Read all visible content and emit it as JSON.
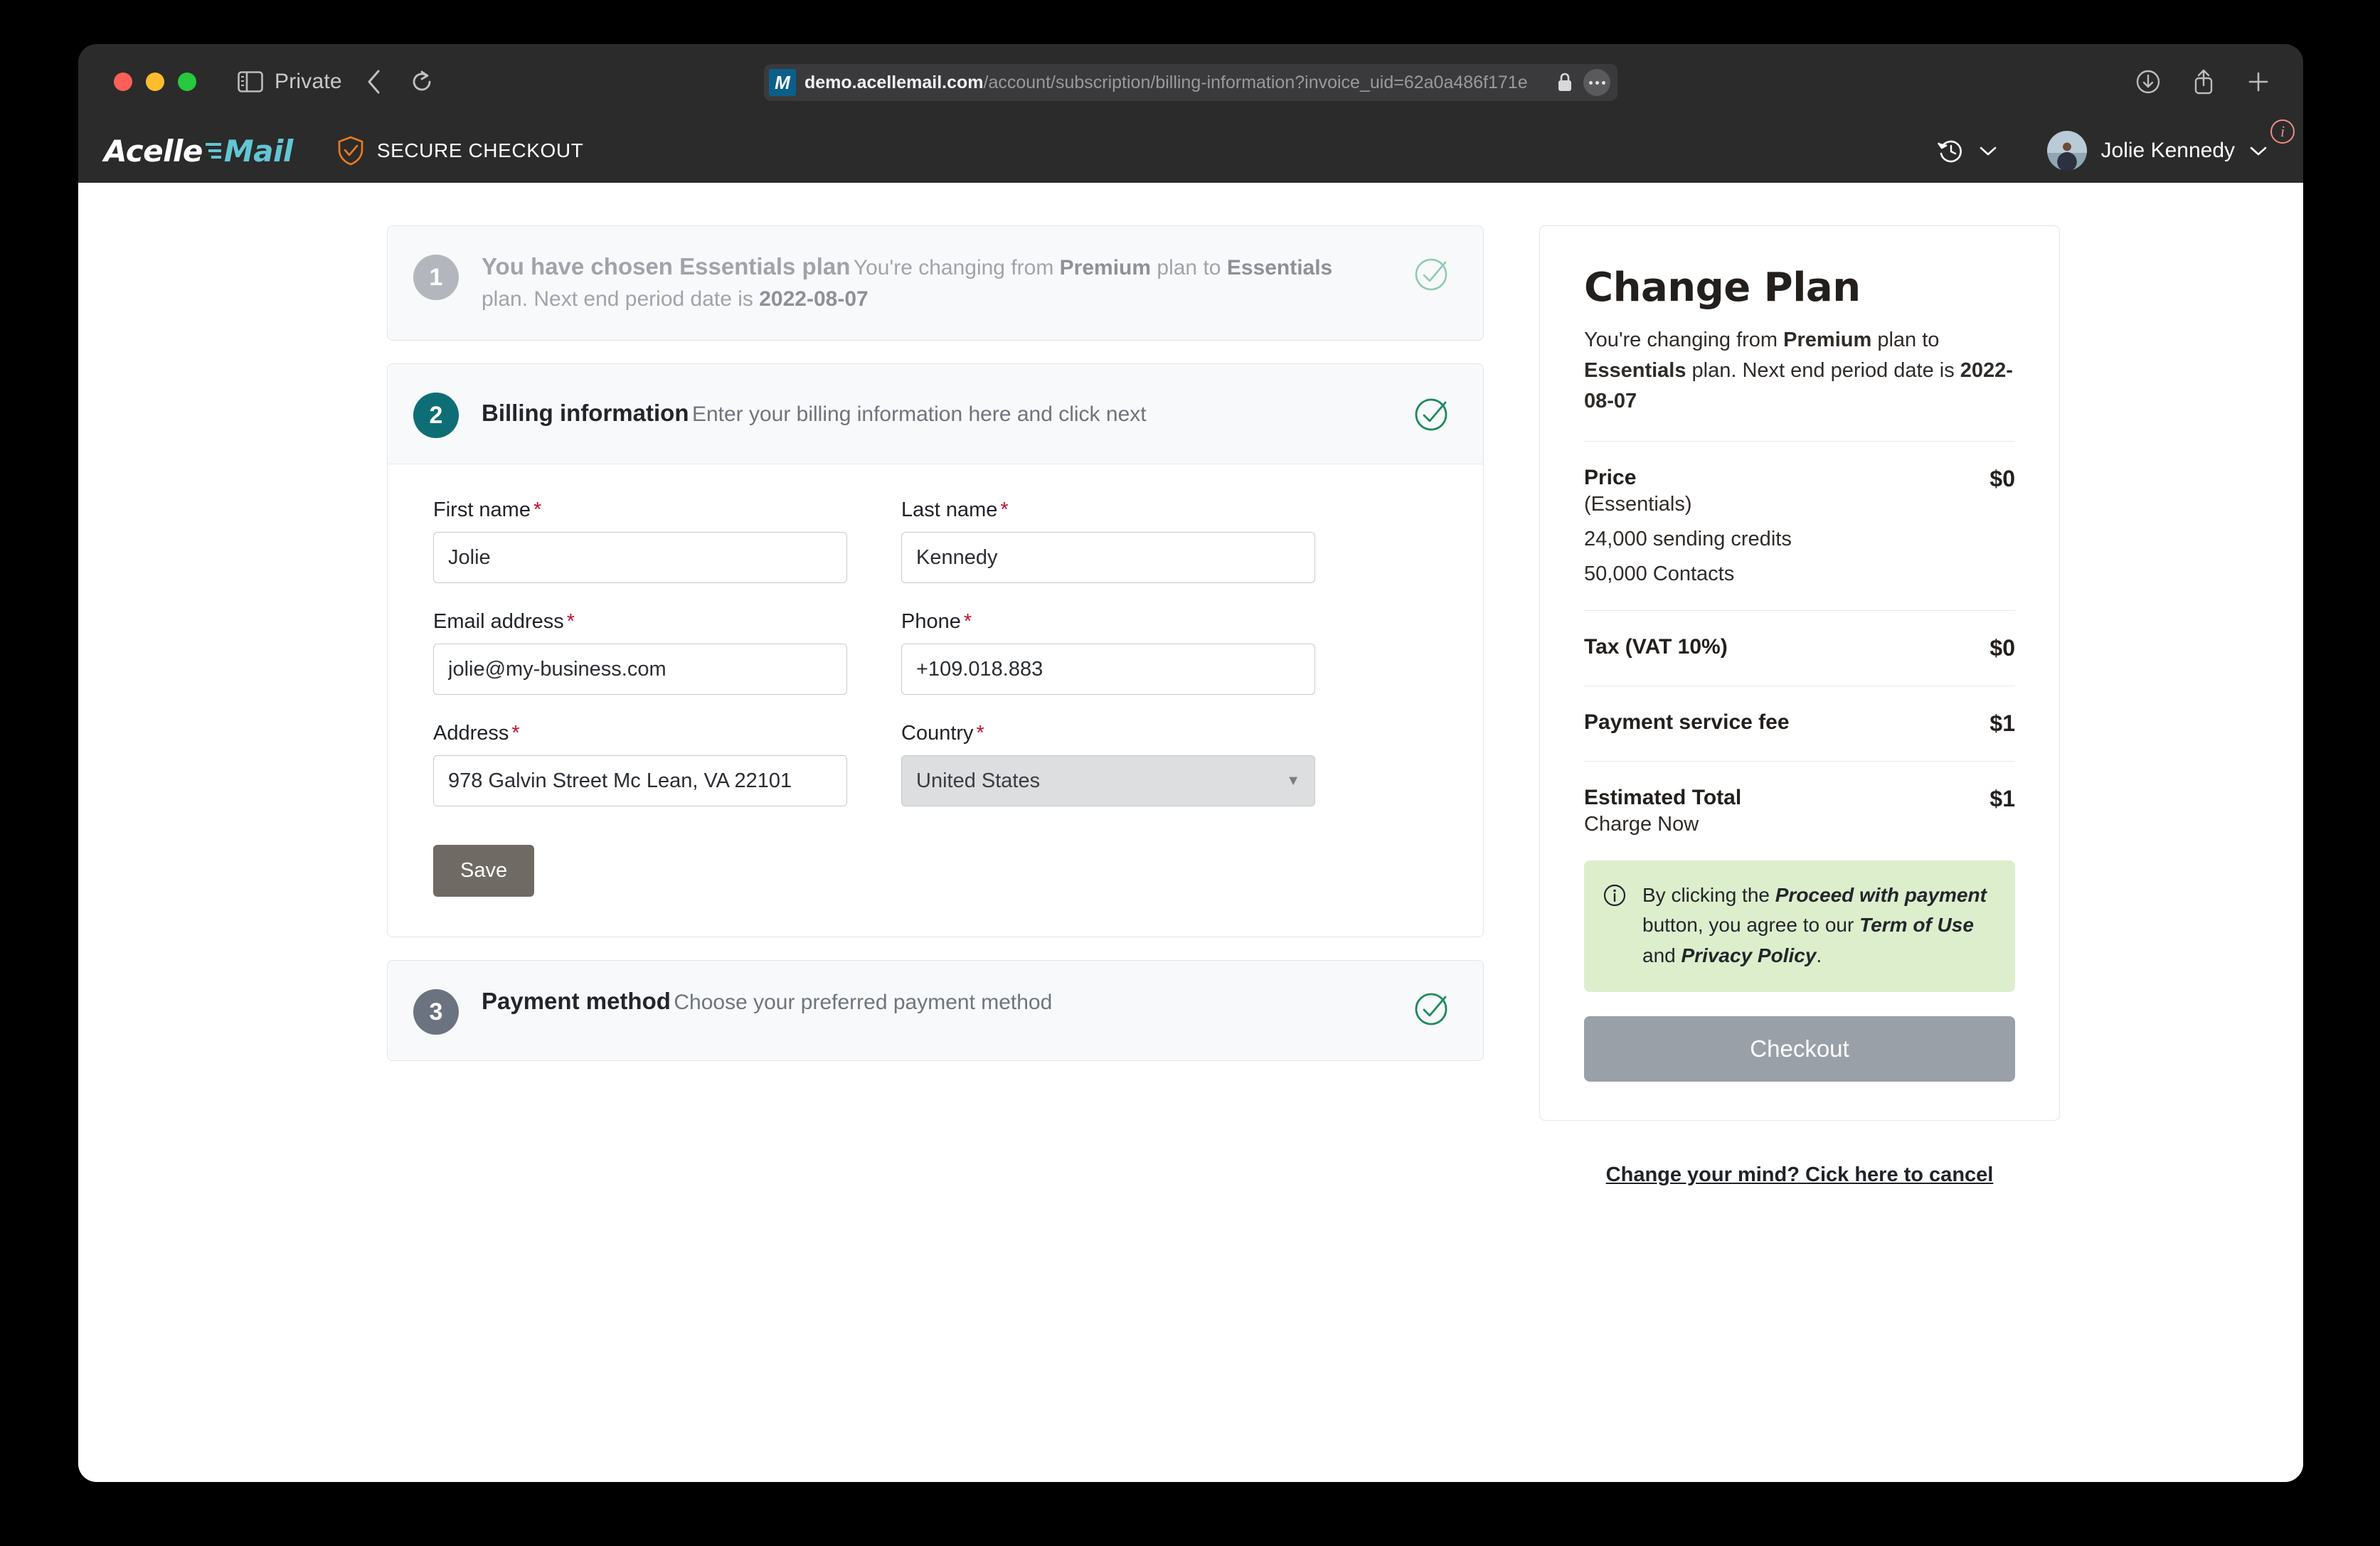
{
  "browser": {
    "private_label": "Private",
    "url": {
      "favicon_letter": "M",
      "host": "demo.acellemail.com",
      "path": "/account/subscription/billing-information?invoice_uid=62a0a486f171e"
    },
    "icons": {
      "sidebar": "sidebar-icon",
      "back": "back-chevron-icon",
      "reload": "reload-icon",
      "lock": "lock-icon",
      "more": "more-dots-icon",
      "download": "download-icon",
      "share": "share-icon",
      "new_tab": "plus-icon"
    }
  },
  "appheader": {
    "logo_first": "Acelle",
    "logo_second": "Mail",
    "secure_label": "SECURE CHECKOUT",
    "user_name": "Jolie Kennedy"
  },
  "steps": [
    {
      "number": "1",
      "title": "You have chosen Essentials plan",
      "sub_prefix": "You're changing from ",
      "sub_b1": "Premium",
      "sub_mid": " plan to ",
      "sub_b2": "Essentials",
      "sub_mid2": " plan. Next end period date is ",
      "sub_b3": "2022-08-07"
    },
    {
      "number": "2",
      "title": "Billing information",
      "sub": "Enter your billing information here and click next"
    },
    {
      "number": "3",
      "title": "Payment method",
      "sub": "Choose your preferred payment method"
    }
  ],
  "form": {
    "first_name": {
      "label": "First name",
      "value": "Jolie",
      "placeholder": "First name"
    },
    "last_name": {
      "label": "Last name",
      "value": "Kennedy",
      "placeholder": "Last name"
    },
    "email": {
      "label": "Email address",
      "value": "jolie@my-business.com",
      "placeholder": "Email address"
    },
    "phone": {
      "label": "Phone",
      "value": "+109.018.883",
      "placeholder": "Phone"
    },
    "address": {
      "label": "Address",
      "value": "978 Galvin Street Mc Lean, VA 22101",
      "placeholder": "Address"
    },
    "country": {
      "label": "Country",
      "value": "United States"
    },
    "save_label": "Save",
    "required_mark": "*"
  },
  "panel": {
    "title": "Change Plan",
    "sub_prefix": "You're changing from ",
    "sub_b1": "Premium",
    "sub_mid": " plan to ",
    "sub_b2": "Essentials",
    "sub_mid2": " plan. Next end period date is ",
    "sub_b3": "2022-08-07",
    "price_label": "Price",
    "price_plan": "(Essentials)",
    "price_amount": "$0",
    "credits": "24,000 sending credits",
    "contacts": "50,000 Contacts",
    "tax_label": "Tax (VAT 10%)",
    "tax_amount": "$0",
    "fee_label": "Payment service fee",
    "fee_amount": "$1",
    "total_label": "Estimated Total",
    "total_sub": "Charge Now",
    "total_amount": "$1",
    "notice": {
      "p1": "By clicking the ",
      "b1": "Proceed with payment",
      "p2": " button, you agree to our ",
      "b2": "Term of Use",
      "p3": " and ",
      "b3": "Privacy Policy",
      "p4": "."
    },
    "checkout_label": "Checkout",
    "cancel_label": "Change your mind? Cick here to cancel"
  },
  "colors": {
    "teal": "#0d6e76",
    "green_check": "#1e8a5a",
    "orange_shield": "#f07b1d",
    "accent_cyan": "#62c6d4",
    "notice_bg": "#ddeecd",
    "required_red": "#c1112b"
  }
}
